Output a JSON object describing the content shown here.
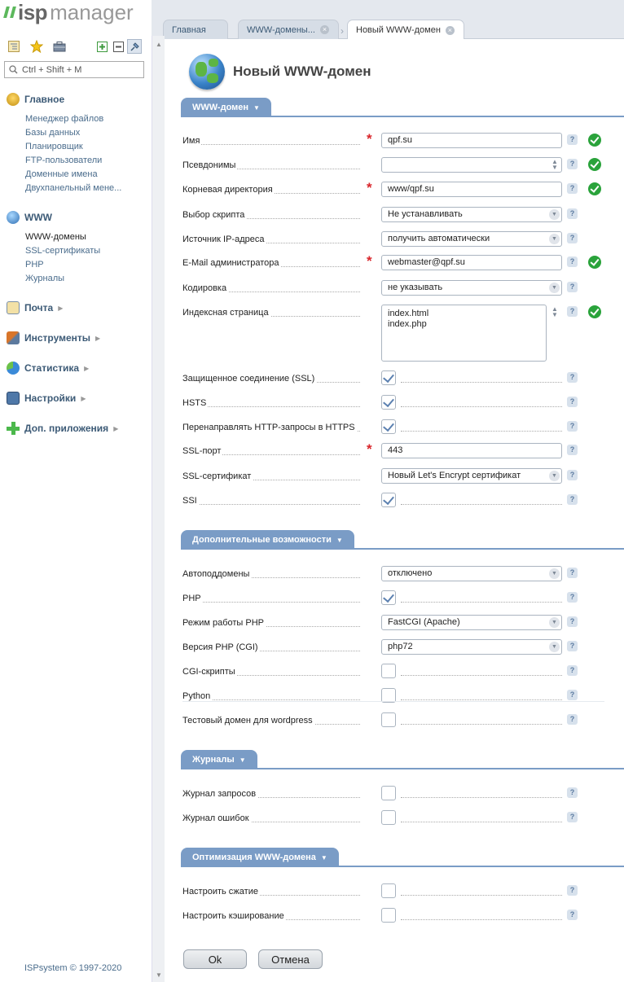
{
  "app": {
    "logo_isp": "isp",
    "logo_manager": "manager"
  },
  "search": {
    "placeholder": "Ctrl + Shift + M"
  },
  "sidebar": {
    "sections": [
      {
        "title": "Главное",
        "items": [
          "Менеджер файлов",
          "Базы данных",
          "Планировщик",
          "FTP-пользователи",
          "Доменные имена",
          "Двухпанельный мене..."
        ]
      },
      {
        "title": "WWW",
        "items": [
          "WWW-домены",
          "SSL-сертификаты",
          "PHP",
          "Журналы"
        ],
        "active_item": "WWW-домены"
      },
      {
        "title": "Почта"
      },
      {
        "title": "Инструменты"
      },
      {
        "title": "Статистика"
      },
      {
        "title": "Настройки"
      },
      {
        "title": "Доп. приложения"
      }
    ],
    "copyright": "ISPsystem © 1997-2020"
  },
  "tabs": [
    {
      "label": "Главная"
    },
    {
      "label": "WWW-домены..."
    },
    {
      "label": "Новый WWW-домен",
      "active": true
    }
  ],
  "page": {
    "title": "Новый WWW-домен"
  },
  "groups": {
    "www": "WWW-домен",
    "extra": "Дополнительные возможности",
    "logs": "Журналы",
    "opt": "Оптимизация WWW-домена"
  },
  "fields": {
    "name": {
      "label": "Имя",
      "value": "qpf.su"
    },
    "aliases": {
      "label": "Псевдонимы",
      "value": ""
    },
    "docroot": {
      "label": "Корневая директория",
      "value": "www/qpf.su"
    },
    "script": {
      "label": "Выбор скрипта",
      "value": "Не устанавливать"
    },
    "ipsrc": {
      "label": "Источник IP-адреса",
      "value": "получить автоматически"
    },
    "email": {
      "label": "E-Mail администратора",
      "value": "webmaster@qpf.su"
    },
    "charset": {
      "label": "Кодировка",
      "value": "не указывать"
    },
    "index": {
      "label": "Индексная страница",
      "line1": "index.html",
      "line2": "index.php"
    },
    "ssl": {
      "label": "Защищенное соединение (SSL)",
      "checked": true
    },
    "hsts": {
      "label": "HSTS",
      "checked": true
    },
    "redirect": {
      "label": "Перенаправлять HTTP-запросы в HTTPS",
      "checked": true
    },
    "sslport": {
      "label": "SSL-порт",
      "value": "443"
    },
    "sslcert": {
      "label": "SSL-сертификат",
      "value": "Новый Let's Encrypt сертификат"
    },
    "ssi": {
      "label": "SSI",
      "checked": true
    },
    "autosub": {
      "label": "Автоподдомены",
      "value": "отключено"
    },
    "php": {
      "label": "PHP",
      "checked": true
    },
    "phpmode": {
      "label": "Режим работы PHP",
      "value": "FastCGI (Apache)"
    },
    "phpver": {
      "label": "Версия PHP (CGI)",
      "value": "php72"
    },
    "cgi": {
      "label": "CGI-скрипты",
      "checked": false
    },
    "python": {
      "label": "Python",
      "checked": false
    },
    "wptest": {
      "label": "Тестовый домен для wordpress",
      "checked": false
    },
    "accesslog": {
      "label": "Журнал запросов",
      "checked": false
    },
    "errorlog": {
      "label": "Журнал ошибок",
      "checked": false
    },
    "gzip": {
      "label": "Настроить сжатие",
      "checked": false
    },
    "cache": {
      "label": "Настроить кэширование",
      "checked": false
    }
  },
  "help_glyph": "?",
  "buttons": {
    "ok": "Ok",
    "cancel": "Отмена"
  },
  "colors": {
    "accent": "#7a9cc6",
    "required": "#d9262b",
    "valid": "#2aa33b",
    "link": "#4a6c8c"
  }
}
